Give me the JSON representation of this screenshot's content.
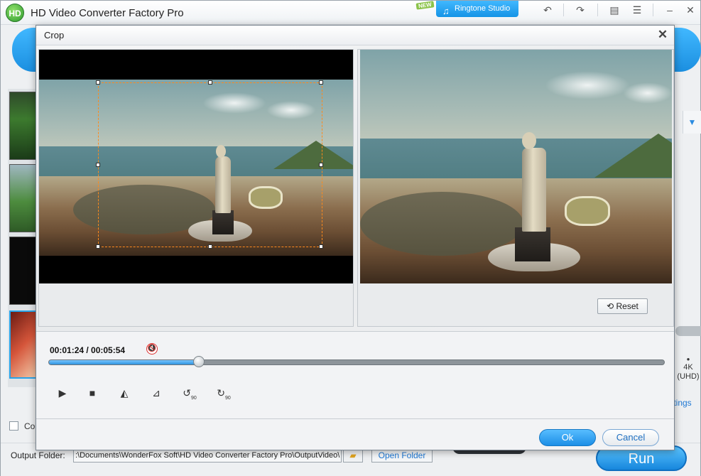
{
  "app": {
    "title": "HD Video Converter Factory Pro",
    "logo_text": "HD",
    "new_badge": "NEW",
    "ringtone_label": "Ringtone Studio",
    "toolbar_icons": [
      "undo-icon",
      "redo-icon",
      "chat-icon",
      "list-icon",
      "minimize-icon",
      "close-icon"
    ]
  },
  "dialog": {
    "title": "Crop",
    "close_glyph": "✕",
    "reset_label": "Reset",
    "timecode": "00:01:24 / 00:05:54",
    "playback_progress": 0.245,
    "ok_label": "Ok",
    "cancel_label": "Cancel",
    "controls": [
      "play-icon",
      "stop-icon",
      "flip-horizontal-icon",
      "flip-vertical-icon",
      "rotate-left-90-icon",
      "rotate-right-90-icon"
    ],
    "rotate_left_glyph": "↺",
    "rotate_right_glyph": "↻",
    "rotate_value": "90"
  },
  "main": {
    "combine_label": "Co",
    "uhd_label_1": "4K",
    "uhd_label_2": "(UHD)",
    "settings_link": "ttings",
    "output_label": "Output Folder:",
    "output_path": ":\\Documents\\WonderFox Soft\\HD Video Converter Factory Pro\\OutputVideo\\",
    "open_folder_label": "Open Folder",
    "run_label": "Run"
  }
}
